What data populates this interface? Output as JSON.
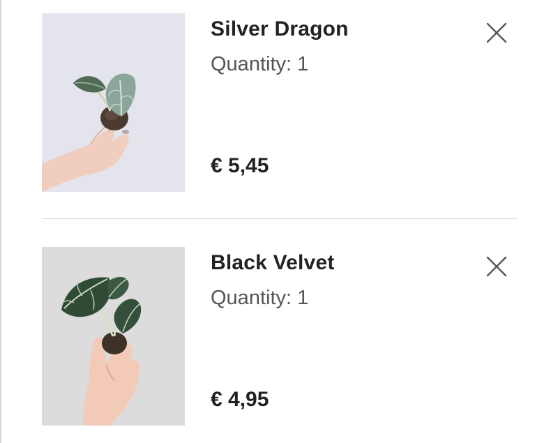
{
  "cart": {
    "items": [
      {
        "name": "Silver Dragon",
        "quantity_label": "Quantity: 1",
        "price": "€ 5,45",
        "image_icon": "plant-photo",
        "remove_icon": "close-icon"
      },
      {
        "name": "Black Velvet",
        "quantity_label": "Quantity: 1",
        "price": "€ 4,95",
        "image_icon": "plant-photo",
        "remove_icon": "close-icon"
      }
    ]
  },
  "colors": {
    "text_primary": "#222222",
    "text_secondary": "#555555",
    "divider": "#d9d9d9",
    "icon": "#555555"
  }
}
